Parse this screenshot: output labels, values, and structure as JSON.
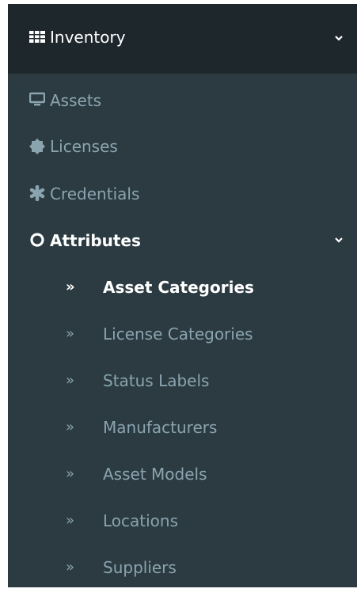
{
  "sidebar": {
    "header": {
      "label": "Inventory",
      "icon": "grid-icon"
    },
    "items": [
      {
        "label": "Assets",
        "icon": "monitor-icon"
      },
      {
        "label": "Licenses",
        "icon": "badge-icon"
      },
      {
        "label": "Credentials",
        "icon": "asterisk-icon"
      },
      {
        "label": "Attributes",
        "icon": "circle-outline-icon",
        "expanded": true
      }
    ],
    "submenu": [
      {
        "label": "Asset Categories",
        "active": true
      },
      {
        "label": "License Categories"
      },
      {
        "label": "Status Labels"
      },
      {
        "label": "Manufacturers"
      },
      {
        "label": "Asset Models"
      },
      {
        "label": "Locations"
      },
      {
        "label": "Suppliers"
      }
    ],
    "arrow_glyph": "»"
  },
  "colors": {
    "sidebar_bg": "#2c3b41",
    "header_bg": "#1e282c",
    "text_muted": "#8aa4af",
    "text_active": "#ffffff"
  }
}
